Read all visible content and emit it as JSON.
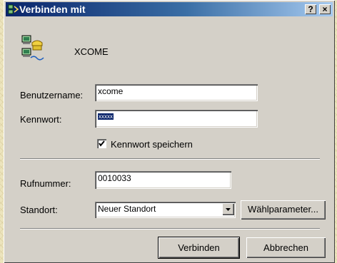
{
  "window": {
    "title": "Verbinden mit",
    "help_button": "?",
    "close_button": "×"
  },
  "connection": {
    "name": "XCOME",
    "icon": "phone-computer-icon"
  },
  "form": {
    "username_label": "Benutzername:",
    "username_value": "xcome",
    "password_label": "Kennwort:",
    "password_value": "xxxxx",
    "save_password_label": "Kennwort speichern",
    "save_password_checked": true,
    "phone_label": "Rufnummer:",
    "phone_value": "0010033",
    "location_label": "Standort:",
    "location_value": "Neuer Standort"
  },
  "buttons": {
    "dial_params": "Wählparameter...",
    "connect": "Verbinden",
    "cancel": "Abbrechen"
  }
}
